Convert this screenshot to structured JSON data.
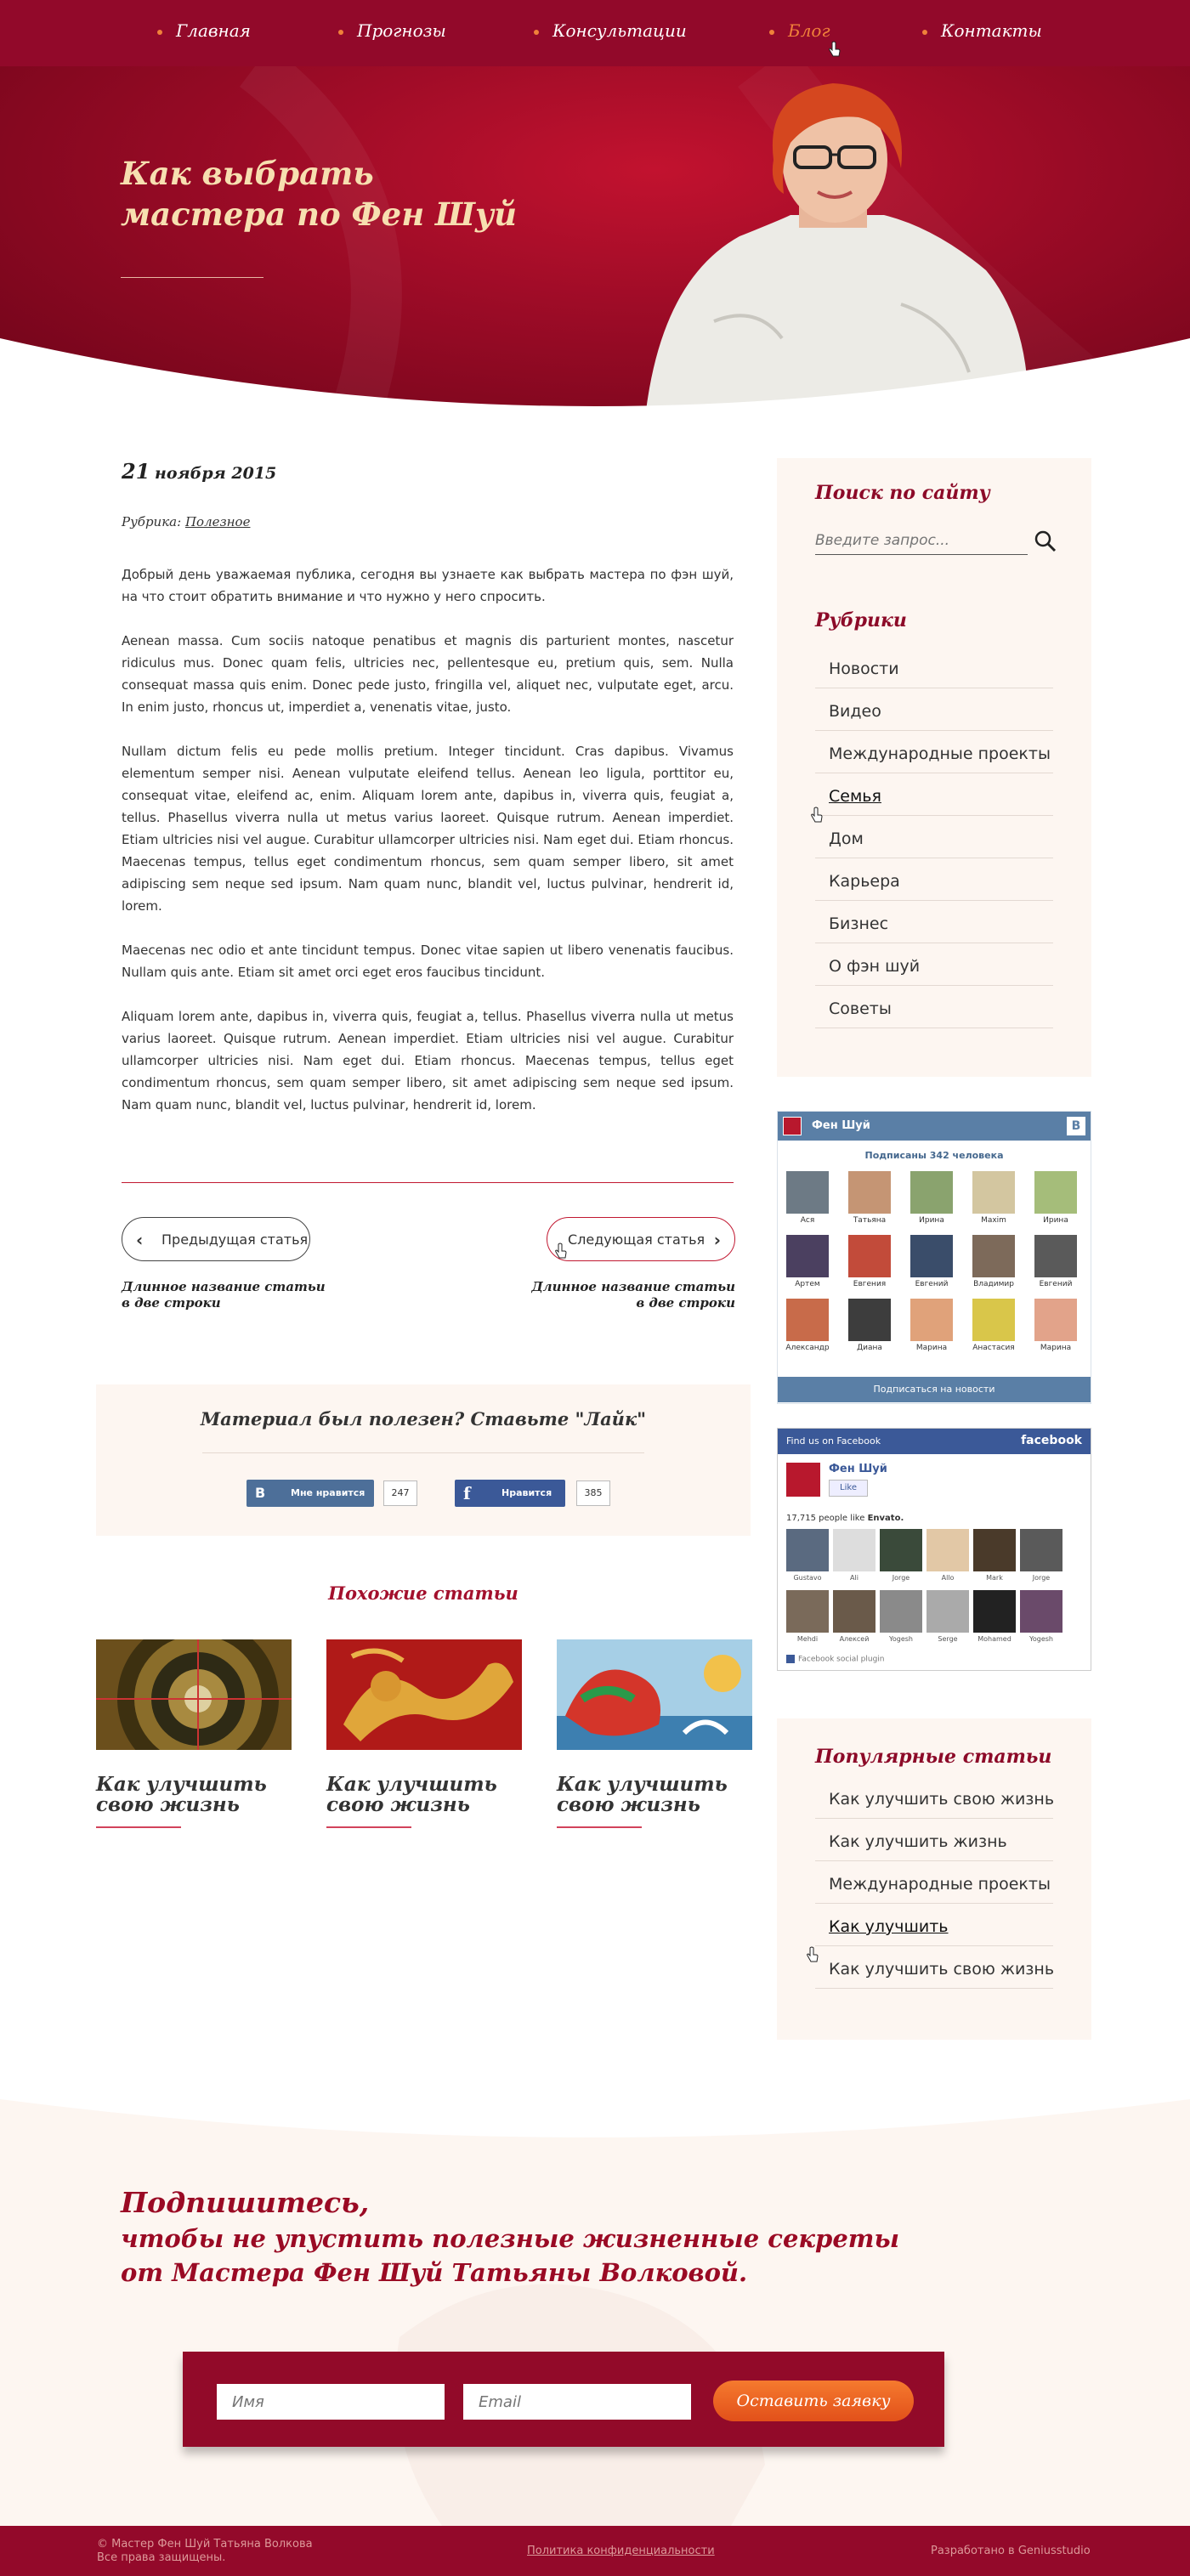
{
  "nav": {
    "items": [
      {
        "label": "Главная"
      },
      {
        "label": "Прогнозы"
      },
      {
        "label": "Консультации"
      },
      {
        "label": "Блог",
        "active": true
      },
      {
        "label": "Контакты"
      }
    ]
  },
  "hero": {
    "title_line1": "Как выбрать",
    "title_line2": "мастера по Фен Шуй"
  },
  "article": {
    "date_day": "21",
    "date_rest": "ноября 2015",
    "rubric_label": "Рубрика:",
    "rubric_value": "Полезное",
    "paragraphs": [
      "Добрый день уважаемая публика, сегодня вы узнаете как выбрать мастера по фэн шуй, на что стоит обратить внимание и что нужно у него спросить.",
      "Aenean massa. Cum sociis natoque penatibus et magnis dis parturient montes, nascetur ridiculus mus. Donec quam felis, ultricies nec, pellentesque eu, pretium quis, sem. Nulla consequat massa quis enim. Donec pede justo, fringilla vel, aliquet nec, vulputate eget, arcu. In enim justo, rhoncus ut, imperdiet a, venenatis vitae, justo.",
      "Nullam dictum felis eu pede mollis pretium. Integer tincidunt. Cras dapibus. Vivamus elementum semper nisi. Aenean vulputate eleifend tellus. Aenean leo ligula, porttitor eu, consequat vitae, eleifend ac, enim. Aliquam lorem ante, dapibus in, viverra quis, feugiat a, tellus. Phasellus viverra nulla ut metus varius laoreet. Quisque rutrum. Aenean imperdiet. Etiam ultricies nisi vel augue. Curabitur ullamcorper ultricies nisi. Nam eget dui. Etiam rhoncus. Maecenas tempus, tellus eget condimentum rhoncus, sem quam semper libero, sit amet adipiscing sem neque sed ipsum. Nam quam nunc, blandit vel, luctus pulvinar, hendrerit id, lorem.",
      "Maecenas nec odio et ante tincidunt tempus. Donec vitae sapien ut libero venenatis faucibus. Nullam quis ante. Etiam sit amet orci eget eros faucibus tincidunt.",
      "Aliquam lorem ante, dapibus in, viverra quis, feugiat a, tellus. Phasellus viverra nulla ut metus varius laoreet. Quisque rutrum. Aenean imperdiet. Etiam ultricies nisi vel augue. Curabitur ullamcorper ultricies nisi. Nam eget dui. Etiam rhoncus. Maecenas tempus, tellus eget condimentum rhoncus, sem quam semper libero, sit amet adipiscing sem neque sed ipsum. Nam quam nunc, blandit vel, luctus pulvinar, hendrerit id, lorem."
    ],
    "prev_label": "Предыдущая статья",
    "next_label": "Следующая статья",
    "prev_title_line1": "Длинное название статьи",
    "prev_title_line2": "в две строки",
    "next_title_line1": "Длинное название статьи",
    "next_title_line2": "в две строки"
  },
  "like_box": {
    "title": "Материал был полезен? Ставьте \"Лайк\"",
    "vk_label": "Мне нравится",
    "vk_count": "247",
    "fb_label": "Нравится",
    "fb_count": "385"
  },
  "related": {
    "title": "Похожие статьи",
    "items": [
      {
        "line1": "Как улучшить",
        "line2": "свою жизнь"
      },
      {
        "line1": "Как улучшить",
        "line2": "свою жизнь"
      },
      {
        "line1": "Как улучшить",
        "line2": "свою жизнь"
      }
    ]
  },
  "sidebar": {
    "search_title": "Поиск по сайту",
    "search_placeholder": "Введите запрос...",
    "categories_title": "Рубрики",
    "categories": [
      "Новости",
      "Видео",
      "Международные проекты",
      "Семья",
      "Дом",
      "Карьера",
      "Бизнес",
      "О фэн шуй",
      "Советы"
    ],
    "popular_title": "Популярные статьи",
    "popular": [
      "Как улучшить свою жизнь",
      "Как улучшить жизнь",
      "Международные проекты",
      "Как улучшить",
      "Как улучшить свою жизнь"
    ]
  },
  "vk_widget": {
    "group_name": "Фен Шуй",
    "logo_letter": "В",
    "subscribers": "Подписаны 342 человека",
    "members": [
      "Ася",
      "Татьяна",
      "Ирина",
      "Maxim",
      "Ирина",
      "Артем",
      "Евгения",
      "Евгений",
      "Владимир",
      "Евгений",
      "Александр",
      "Диана",
      "Марина",
      "Анастасия",
      "Марина"
    ],
    "subscribe_button": "Подписаться на новости"
  },
  "fb_widget": {
    "header_left": "Find us on Facebook",
    "header_right": "facebook",
    "page_name": "Фен Шуй",
    "like_button": "Like",
    "likes_text": "17,715 people like",
    "likes_bold": "Envato.",
    "members": [
      "Gustavo",
      "Ali",
      "Jorge",
      "Allo",
      "Mark",
      "Jorge",
      "Mehdi",
      "Алексей",
      "Yogesh",
      "Serge",
      "Mohamed",
      "Yogesh"
    ],
    "plugin_label": "Facebook social plugin"
  },
  "subscribe": {
    "line1": "Подпишитесь,",
    "line2": "чтобы не упустить полезные жизненные секреты",
    "line3": "от Мастера Фен Шуй Татьяны Волковой.",
    "name_placeholder": "Имя",
    "email_placeholder": "Email",
    "submit_label": "Оставить заявку"
  },
  "footer": {
    "copyright_line1": "© Мастер Фен Шуй Татьяна Волкова",
    "copyright_line2": "Все права защищены.",
    "privacy": "Политика конфиденциальности",
    "developer": "Разработано в Geniusstudio"
  },
  "colors": {
    "brand": "#920a29",
    "accent": "#f0813a",
    "cream": "#fdf6f1",
    "vk_blue": "#5a7fa6",
    "fb_blue": "#3b5998"
  }
}
